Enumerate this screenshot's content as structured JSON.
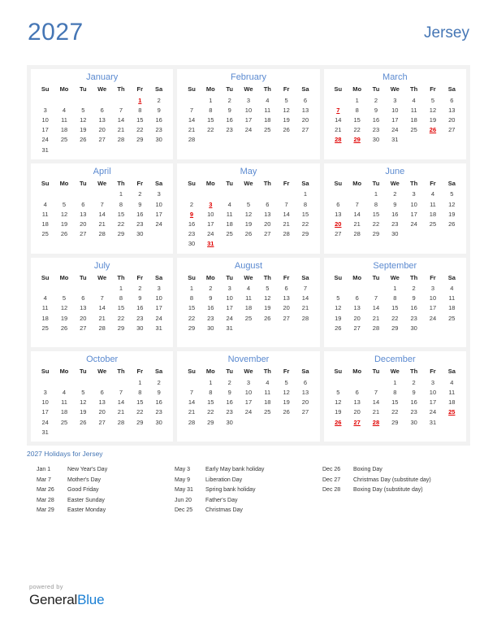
{
  "header": {
    "year": "2027",
    "region": "Jersey"
  },
  "weekdays": [
    "Su",
    "Mo",
    "Tu",
    "We",
    "Th",
    "Fr",
    "Sa"
  ],
  "months": [
    {
      "name": "January",
      "start": 5,
      "days": 31,
      "holidays": [
        1
      ]
    },
    {
      "name": "February",
      "start": 1,
      "days": 28,
      "holidays": []
    },
    {
      "name": "March",
      "start": 1,
      "days": 31,
      "holidays": [
        7,
        26,
        28,
        29
      ]
    },
    {
      "name": "April",
      "start": 4,
      "days": 30,
      "holidays": []
    },
    {
      "name": "May",
      "start": 6,
      "days": 31,
      "holidays": [
        3,
        9,
        31
      ]
    },
    {
      "name": "June",
      "start": 2,
      "days": 30,
      "holidays": [
        20
      ]
    },
    {
      "name": "July",
      "start": 4,
      "days": 31,
      "holidays": []
    },
    {
      "name": "August",
      "start": 0,
      "days": 31,
      "holidays": []
    },
    {
      "name": "September",
      "start": 3,
      "days": 30,
      "holidays": []
    },
    {
      "name": "October",
      "start": 5,
      "days": 31,
      "holidays": []
    },
    {
      "name": "November",
      "start": 1,
      "days": 30,
      "holidays": []
    },
    {
      "name": "December",
      "start": 3,
      "days": 31,
      "holidays": [
        25,
        26,
        27,
        28
      ]
    }
  ],
  "holidays_section": {
    "title": "2027 Holidays for Jersey",
    "columns": [
      [
        {
          "date": "Jan 1",
          "name": "New Year's Day"
        },
        {
          "date": "Mar 7",
          "name": "Mother's Day"
        },
        {
          "date": "Mar 26",
          "name": "Good Friday"
        },
        {
          "date": "Mar 28",
          "name": "Easter Sunday"
        },
        {
          "date": "Mar 29",
          "name": "Easter Monday"
        }
      ],
      [
        {
          "date": "May 3",
          "name": "Early May bank holiday"
        },
        {
          "date": "May 9",
          "name": "Liberation Day"
        },
        {
          "date": "May 31",
          "name": "Spring bank holiday"
        },
        {
          "date": "Jun 20",
          "name": "Father's Day"
        },
        {
          "date": "Dec 25",
          "name": "Christmas Day"
        }
      ],
      [
        {
          "date": "Dec 26",
          "name": "Boxing Day"
        },
        {
          "date": "Dec 27",
          "name": "Christmas Day (substitute day)"
        },
        {
          "date": "Dec 28",
          "name": "Boxing Day (substitute day)"
        }
      ]
    ]
  },
  "footer": {
    "powered_by": "powered by",
    "brand_first": "General",
    "brand_second": "Blue"
  },
  "colors": {
    "accent": "#4576b5",
    "month_name": "#5b8ad0",
    "holiday": "#e00000",
    "panel_bg": "#f2f2f2",
    "brand_blue": "#1a7fd4"
  }
}
